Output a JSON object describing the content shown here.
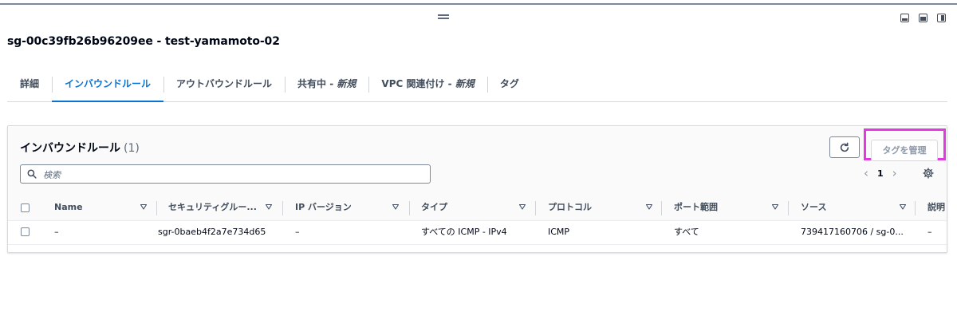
{
  "window": {
    "title": "sg-00c39fb26b96209ee - test-yamamoto-02"
  },
  "tabs": [
    {
      "label": "詳細",
      "active": false
    },
    {
      "label": "インバウンドルール",
      "active": true
    },
    {
      "label": "アウトバウンドルール",
      "active": false
    },
    {
      "label": "共有中 - ",
      "label_em": "新規",
      "active": false
    },
    {
      "label": "VPC 関連付け - ",
      "label_em": "新規",
      "active": false
    },
    {
      "label": "タグ",
      "active": false
    }
  ],
  "panel": {
    "title": "インバウンドルール",
    "count": "(1)",
    "manage_tags_label": "タグを管理",
    "search_placeholder": "検索",
    "page_number": "1",
    "accent_color": "#0972d3",
    "highlight_color": "#e03ae0"
  },
  "table": {
    "columns": [
      "Name",
      "セキュリティグルー...",
      "IP バージョン",
      "タイプ",
      "プロトコル",
      "ポート範囲",
      "ソース",
      "説明"
    ],
    "rows": [
      {
        "name": "–",
        "sg_rule": "sgr-0baeb4f2a7e734d65",
        "ip_version": "–",
        "type": "すべての ICMP - IPv4",
        "protocol": "ICMP",
        "port_range": "すべて",
        "source": "739417160706 / sg-0...",
        "description": "–"
      }
    ]
  },
  "icons": {
    "refresh": "refresh-icon",
    "search": "search-icon",
    "settings": "gear-icon",
    "sort": "caret-down-icon"
  }
}
